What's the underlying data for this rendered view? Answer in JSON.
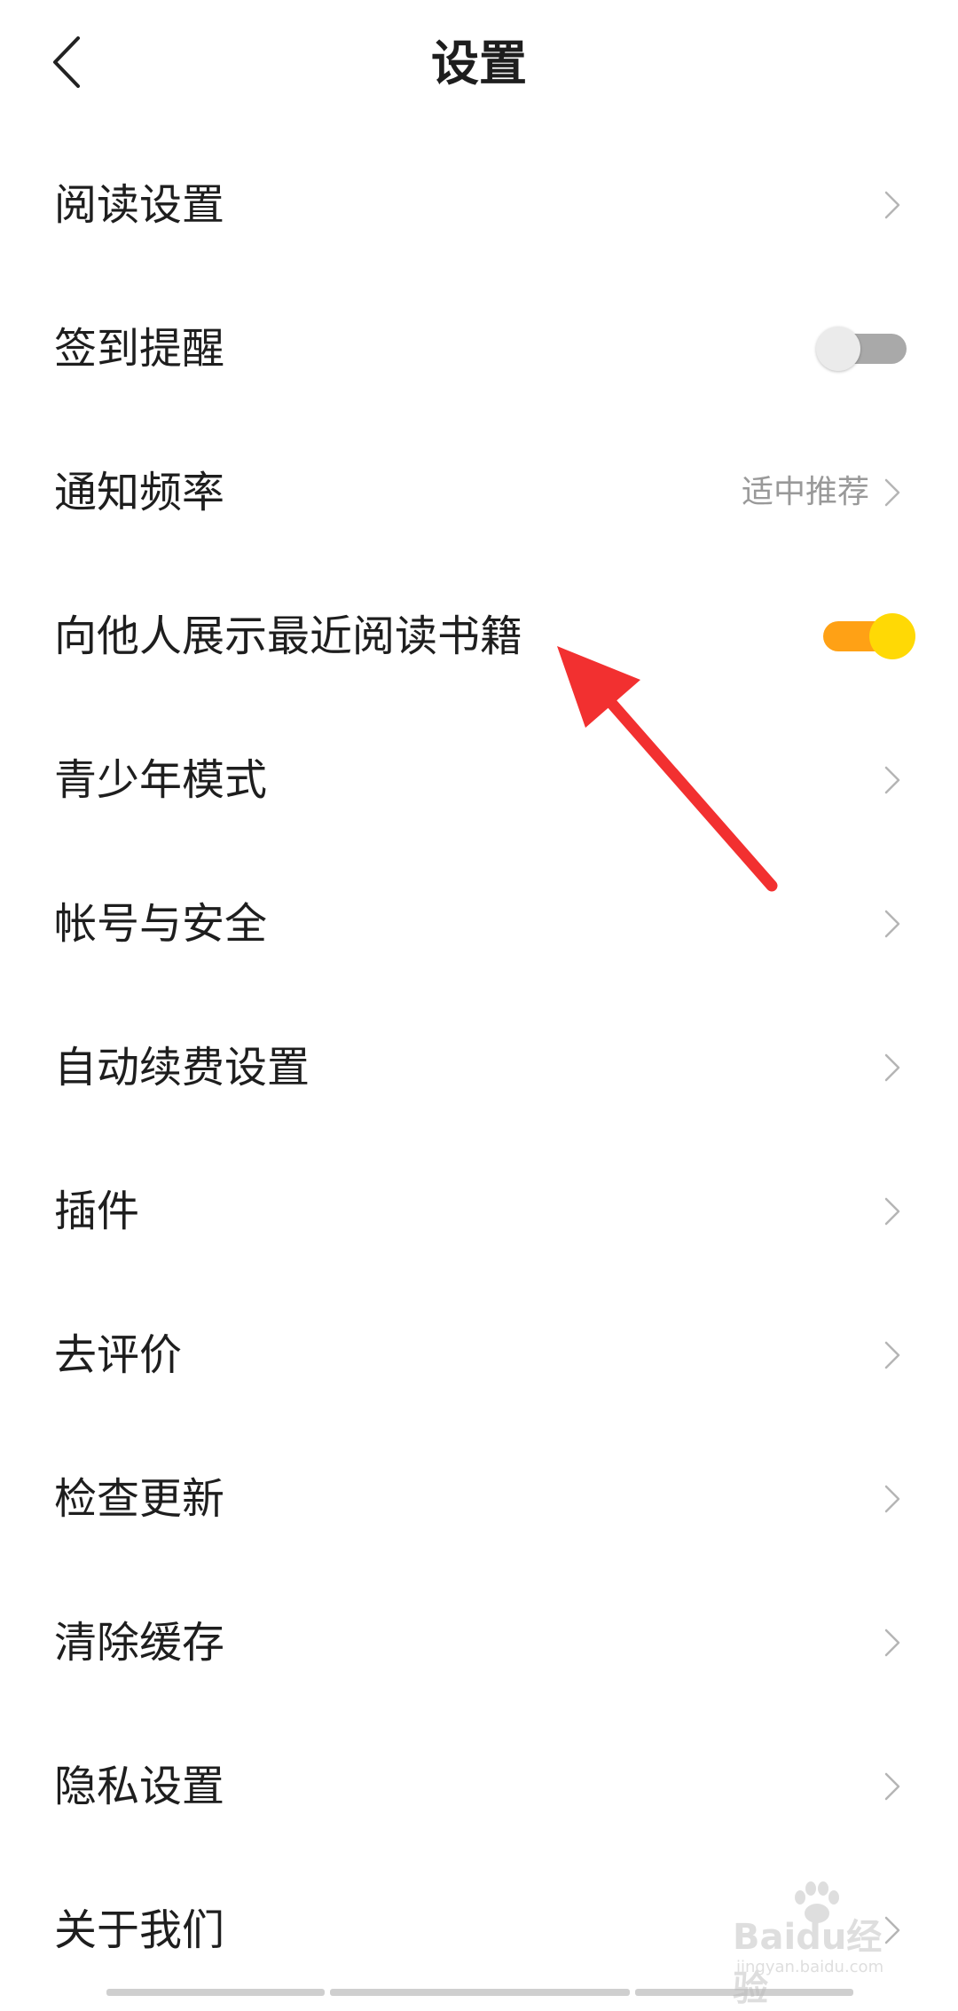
{
  "header": {
    "title": "设置",
    "back_icon": "chevron-left-icon"
  },
  "settings": [
    {
      "label": "阅读设置",
      "control": "chevron"
    },
    {
      "label": "签到提醒",
      "control": "toggle",
      "on": false
    },
    {
      "label": "通知频率",
      "control": "chevron",
      "value": "适中推荐"
    },
    {
      "label": "向他人展示最近阅读书籍",
      "control": "toggle",
      "on": true
    },
    {
      "label": "青少年模式",
      "control": "chevron"
    },
    {
      "label": "帐号与安全",
      "control": "chevron"
    },
    {
      "label": "自动续费设置",
      "control": "chevron"
    },
    {
      "label": "插件",
      "control": "chevron"
    },
    {
      "label": "去评价",
      "control": "chevron"
    },
    {
      "label": "检查更新",
      "control": "chevron"
    },
    {
      "label": "清除缓存",
      "control": "chevron"
    },
    {
      "label": "隐私设置",
      "control": "chevron"
    },
    {
      "label": "关于我们",
      "control": "chevron"
    }
  ],
  "colors": {
    "toggle_on_track": "#ffa115",
    "toggle_on_knob": "#ffd905",
    "toggle_off_track": "#a9a9a9",
    "toggle_off_knob": "#ebebeb",
    "annotation_arrow": "#f23030",
    "secondary_text": "#999999"
  },
  "watermark": {
    "brand": "Baidu经验",
    "domain": "jingyan.baidu.com"
  }
}
